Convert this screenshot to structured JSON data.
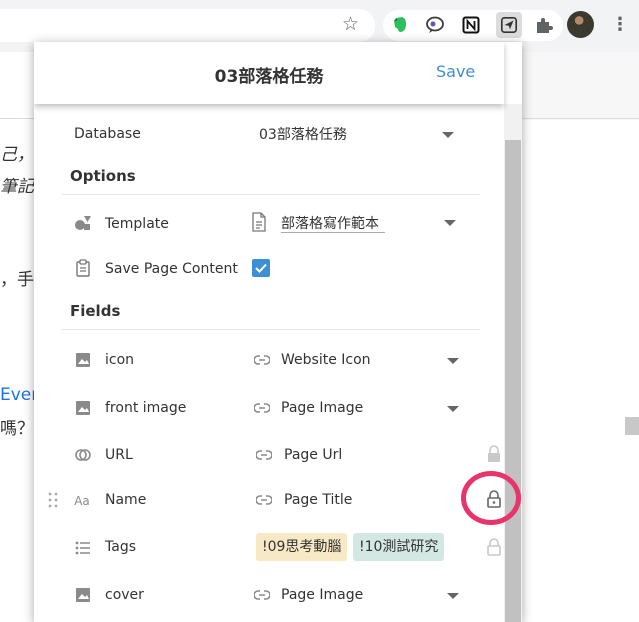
{
  "browser": {
    "star_icon": "star-icon",
    "extensions": [
      "evernote-icon",
      "chat-bubble-icon",
      "notion-icon",
      "send-icon",
      "puzzle-icon"
    ],
    "menu_glyph": "⋮"
  },
  "background_page": {
    "lines": [
      {
        "text": "己，"
      },
      {
        "text": "筆記"
      },
      {
        "text": "，手"
      },
      {
        "text": "Ever",
        "link": true
      },
      {
        "text": "嗎？"
      }
    ]
  },
  "popup": {
    "title": "03部落格任務",
    "save_label": "Save",
    "database": {
      "label": "Database",
      "value": "03部落格任務"
    },
    "options_heading": "Options",
    "template": {
      "label": "Template",
      "value": "部落格寫作範本"
    },
    "save_page_content": {
      "label": "Save Page Content",
      "checked": true
    },
    "fields_heading": "Fields",
    "fields": [
      {
        "label": "icon",
        "value": "Website Icon",
        "control": "dropdown"
      },
      {
        "label": "front image",
        "value": "Page Image",
        "control": "dropdown"
      },
      {
        "label": "URL",
        "value": "Page Url",
        "control": "lock"
      },
      {
        "label": "Name",
        "value": "Page Title",
        "control": "lock"
      },
      {
        "label": "Tags",
        "tags": [
          "!09思考動腦",
          "!10測試研究"
        ],
        "control": "lock"
      },
      {
        "label": "cover",
        "value": "Page Image",
        "control": "dropdown"
      }
    ]
  },
  "colors": {
    "accent": "#3d8fd6",
    "tag1_bg": "#f7e8c6",
    "tag2_bg": "#d4e8e3",
    "highlight": "#e8336b"
  }
}
